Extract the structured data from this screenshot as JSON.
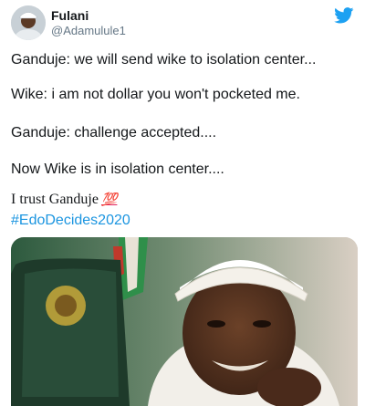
{
  "user": {
    "display_name": "Fulani",
    "handle": "@Adamulule1",
    "avatar_icon": "profile-avatar"
  },
  "brand": {
    "logo_icon": "twitter-bird-icon",
    "color": "#1da1f2"
  },
  "tweet": {
    "lines": [
      "Ganduje: we will send wike to isolation center...",
      "Wike: i am not dollar you won't pocketed me.",
      "Ganduje: challenge accepted....",
      "Now Wike is in isolation center....",
      "I trust Ganduje"
    ],
    "emoji": "💯",
    "hashtag": "#EdoDecides2020",
    "hashtag_color": "#1b95e0"
  },
  "media": {
    "description_icon": "photo-image"
  }
}
